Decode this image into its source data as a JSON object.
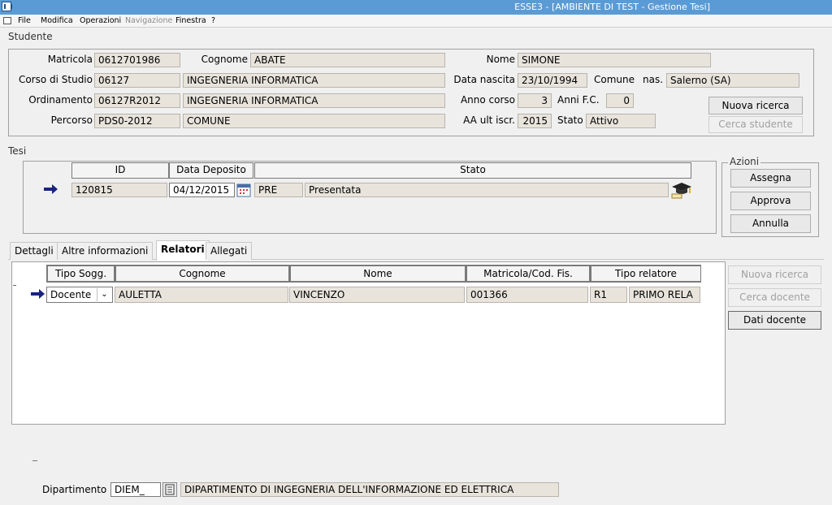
{
  "window": {
    "title": "ESSE3 - [AMBIENTE DI TEST - Gestione Tesi]"
  },
  "menu": {
    "file": "File",
    "modifica": "Modifica",
    "operazioni": "Operazioni",
    "navigazione": "Navigazione",
    "finestra": "Finestra",
    "help": "?"
  },
  "studente": {
    "group_label": "Studente",
    "matricola_label": "Matricola",
    "matricola": "0612701986",
    "cognome_label": "Cognome",
    "cognome": "ABATE",
    "nome_label": "Nome",
    "nome": "SIMONE",
    "corso_label": "Corso di Studio",
    "corso_code": "06127",
    "corso_desc": "INGEGNERIA INFORMATICA",
    "data_nascita_label": "Data nascita",
    "data_nascita": "23/10/1994",
    "comune_label": "Comune",
    "nas_label": "nas.",
    "comune": "Salerno (SA)",
    "ordinamento_label": "Ordinamento",
    "ordinamento_code": "06127R2012",
    "ordinamento_desc": "INGEGNERIA INFORMATICA",
    "anno_corso_label": "Anno corso",
    "anno_corso": "3",
    "anni_fc_label": "Anni F.C.",
    "anni_fc": "0",
    "percorso_label": "Percorso",
    "percorso_code": "PDS0-2012",
    "percorso_desc": "COMUNE",
    "aa_label": "AA ult iscr.",
    "aa": "2015",
    "stato_label": "Stato",
    "stato": "Attivo",
    "btn_nuova_ricerca": "Nuova ricerca",
    "btn_cerca_studente": "Cerca studente"
  },
  "tesi": {
    "group_label": "Tesi",
    "col_id": "ID",
    "col_data": "Data Deposito",
    "col_stato": "Stato",
    "id": "120815",
    "data_deposito": "04/12/2015",
    "stato_code": "PRE",
    "stato_desc": "Presentata",
    "azioni_label": "Azioni",
    "btn_assegna": "Assegna",
    "btn_approva": "Approva",
    "btn_annulla": "Annulla"
  },
  "tabs": [
    "Dettagli",
    "Altre informazioni",
    "Relatori",
    "Allegati"
  ],
  "relatori": {
    "col_tipo_sogg": "Tipo Sogg.",
    "col_cognome": "Cognome",
    "col_nome": "Nome",
    "col_matricola": "Matricola/Cod. Fis.",
    "col_tipo_relatore": "Tipo relatore",
    "row": {
      "tipo_sogg": "Docente",
      "cognome": "AULETTA",
      "nome": "VINCENZO",
      "matricola": "001366",
      "tipo_code": "R1",
      "tipo_desc": "PRIMO RELA"
    },
    "btn_nuova_ricerca": "Nuova ricerca",
    "btn_cerca_docente": "Cerca docente",
    "btn_dati_docente": "Dati docente"
  },
  "dipartimento": {
    "label": "Dipartimento",
    "code": "DIEM_",
    "desc": "DIPARTIMENTO DI INGEGNERIA DELL'INFORMAZIONE ED ELETTRICA"
  }
}
